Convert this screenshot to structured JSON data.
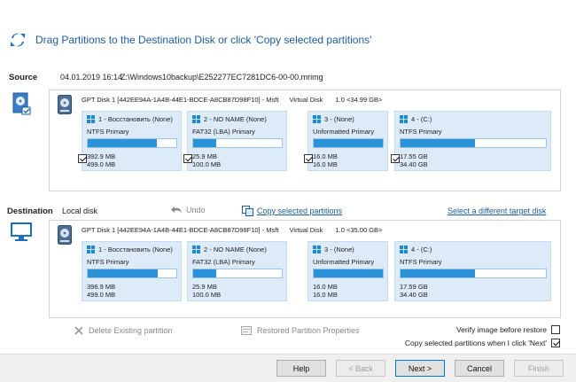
{
  "header": {
    "title": "Drag Partitions to the Destination Disk or click 'Copy selected partitions'"
  },
  "source": {
    "label": "Source",
    "date": "04.01.2019 16:14",
    "path": "Z:\\Windows10backup\\E252277EC7281DC6-00-00.mrimg",
    "disk_checkbox_checked": true,
    "disk": {
      "name": "GPT Disk 1 [442EE94A-1A4B-44E1-BDCE-A8CB87D98F10] - Msft",
      "type": "Virtual Disk",
      "size": "1.0   <34.99 GB>",
      "partitions": [
        {
          "title": "1 - Восстановить (None)",
          "fs": "NTFS Primary",
          "used": "392.9 MB",
          "total": "499.0 MB",
          "fill": 0.78,
          "checked": true
        },
        {
          "title": "2 - NO NAME (None)",
          "fs": "FAT32 (LBA) Primary",
          "used": "25.9 MB",
          "total": "100.0 MB",
          "fill": 0.26,
          "checked": true
        },
        {
          "title": "3 - (None)",
          "fs": "Unformatted Primary",
          "used": "16.0 MB",
          "total": "16.0 MB",
          "fill": 1.0,
          "checked": true
        },
        {
          "title": "4 - (C:)",
          "fs": "NTFS Primary",
          "used": "17.55 GB",
          "total": "34.40 GB",
          "fill": 0.51,
          "checked": true
        }
      ]
    }
  },
  "destination": {
    "label": "Destination",
    "disk_label": "Local disk",
    "undo_label": "Undo",
    "copy_selected_label": "Copy selected partitions",
    "select_target_label": "Select a different target disk",
    "disk": {
      "name": "GPT Disk 1 [442EE94A-1A4B-44E1-BDCE-A8CB87D98F10] - Msft",
      "type": "Virtual Disk",
      "size": "1.0   <35.00 GB>",
      "partitions": [
        {
          "title": "1 - Восстановить (None)",
          "fs": "NTFS Primary",
          "used": "396.9 MB",
          "total": "499.0 MB",
          "fill": 0.79
        },
        {
          "title": "2 - NO NAME (None)",
          "fs": "FAT32 (LBA) Primary",
          "used": "25.9 MB",
          "total": "100.0 MB",
          "fill": 0.26
        },
        {
          "title": "3 - (None)",
          "fs": "Unformatted Primary",
          "used": "16.0 MB",
          "total": "16.0 MB",
          "fill": 1.0
        },
        {
          "title": "4 - (C:)",
          "fs": "NTFS Primary",
          "used": "17.59 GB",
          "total": "34.40 GB",
          "fill": 0.51
        }
      ]
    }
  },
  "actions": {
    "delete_label": "Delete Existing partition",
    "properties_label": "Restored Partition Properties"
  },
  "options": {
    "verify_label": "Verify image before restore",
    "verify_checked": false,
    "copy_on_next_label": "Copy selected partitions when I click 'Next'",
    "copy_on_next_checked": true
  },
  "buttons": {
    "help": "Help",
    "back": "< Back",
    "next": "Next >",
    "cancel": "Cancel",
    "finish": "Finish"
  },
  "colors": {
    "accent": "#1a5ea8",
    "bar_fill": "#2a93d8",
    "partition_bg": "#ddebf8"
  }
}
